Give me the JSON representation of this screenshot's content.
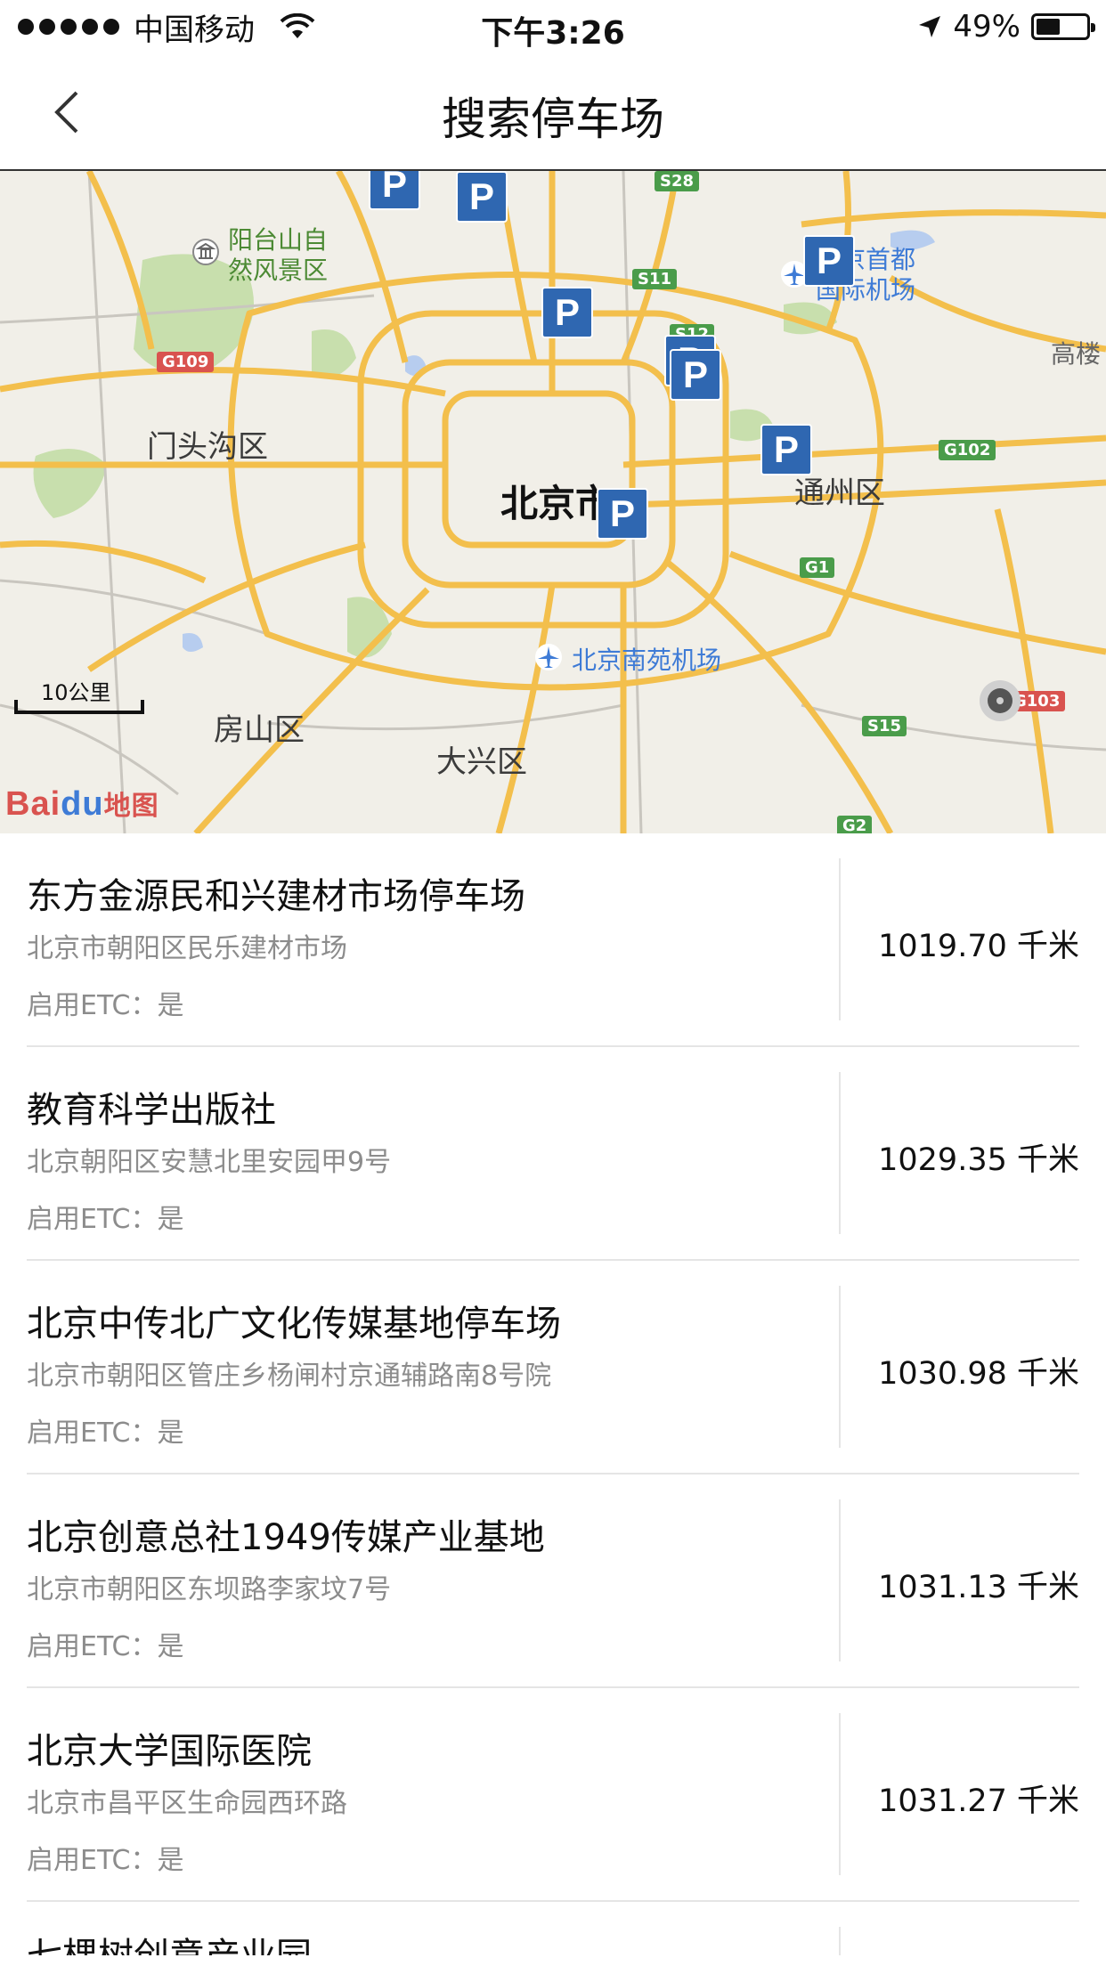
{
  "status_bar": {
    "carrier": "中国移动",
    "time": "下午3:26",
    "battery": "49%",
    "battery_level": 0.49
  },
  "nav": {
    "title": "搜索停车场",
    "back_icon": "chevron-left-icon"
  },
  "map": {
    "city_label": "北京市",
    "districts": [
      "门头沟区",
      "房山区",
      "大兴区",
      "通州区",
      "高楼"
    ],
    "pois": [
      "阳台山自然风景区",
      "首都国际机场",
      "北京南苑机场"
    ],
    "poi_lines": {
      "yangtai_1": "阳台山自",
      "yangtai_2": "然风景区",
      "airport_1": "京首都",
      "airport_2": "国际机场",
      "nanyuan": "北京南苑机场"
    },
    "road_shields": [
      "S28",
      "S11",
      "S12",
      "G109",
      "G102",
      "G1",
      "S15",
      "G103",
      "G2"
    ],
    "parking_marker": "P",
    "scale_label": "10公里",
    "logo": {
      "bai": "Bai",
      "du": "du",
      "tu": "地图"
    }
  },
  "parking_lots": [
    {
      "name": "东方金源民和兴建材市场停车场",
      "address": "北京市朝阳区民乐建材市场",
      "etc": "启用ETC：是",
      "distance": "1019.70 千米"
    },
    {
      "name": "教育科学出版社",
      "address": "北京朝阳区安慧北里安园甲9号",
      "etc": "启用ETC：是",
      "distance": "1029.35 千米"
    },
    {
      "name": "北京中传北广文化传媒基地停车场",
      "address": "北京市朝阳区管庄乡杨闸村京通辅路南8号院",
      "etc": "启用ETC：是",
      "distance": "1030.98 千米"
    },
    {
      "name": "北京创意总社1949传媒产业基地",
      "address": "北京市朝阳区东坝路李家坟7号",
      "etc": "启用ETC：是",
      "distance": "1031.13 千米"
    },
    {
      "name": "北京大学国际医院",
      "address": "北京市昌平区生命园西环路",
      "etc": "启用ETC：是",
      "distance": "1031.27 千米"
    },
    {
      "name": "七棵树创意产业园"
    }
  ]
}
